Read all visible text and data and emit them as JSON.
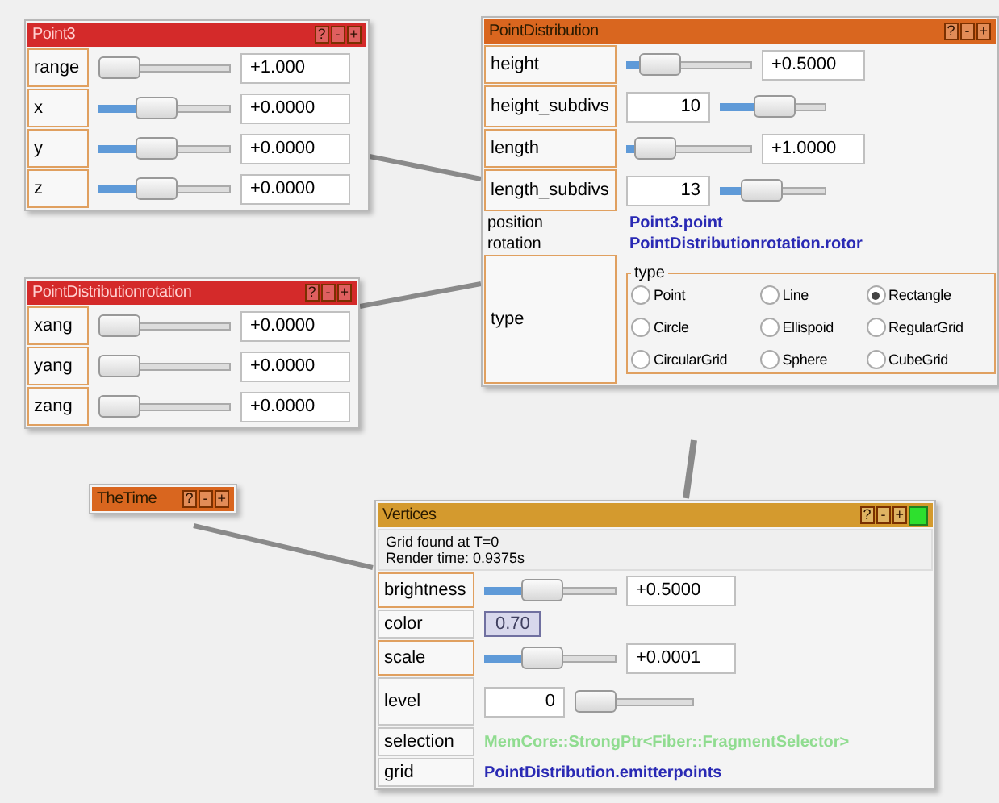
{
  "nodes": [
    {
      "title": "Point3",
      "color": "#d42a2a",
      "buttons": [
        "?",
        "-",
        "+"
      ],
      "indicator": false,
      "rows": [
        {
          "kind": "slider",
          "label": "range",
          "level": 0.0,
          "value": "+1.000"
        },
        {
          "kind": "slider",
          "label": "x",
          "level": 0.4,
          "value": "+0.0000"
        },
        {
          "kind": "slider",
          "label": "y",
          "level": 0.4,
          "value": "+0.0000"
        },
        {
          "kind": "slider",
          "label": "z",
          "level": 0.4,
          "value": "+0.0000"
        }
      ]
    },
    {
      "title": "PointDistributionrotation",
      "color": "#d42a2a",
      "buttons": [
        "?",
        "-",
        "+"
      ],
      "indicator": false,
      "rows": [
        {
          "kind": "slider",
          "label": "xang",
          "level": 0.0,
          "value": "+0.0000"
        },
        {
          "kind": "slider",
          "label": "yang",
          "level": 0.0,
          "value": "+0.0000"
        },
        {
          "kind": "slider",
          "label": "zang",
          "level": 0.0,
          "value": "+0.0000"
        }
      ]
    },
    {
      "title": "PointDistribution",
      "color": "#d9661f",
      "buttons": [
        "?",
        "-",
        "+"
      ],
      "indicator": false,
      "rows": [
        {
          "kind": "slider",
          "label": "height",
          "level": 0.15,
          "value": "+0.5000"
        },
        {
          "kind": "counter",
          "label": "height_subdivs",
          "level": 0.5,
          "value": "10"
        },
        {
          "kind": "slider",
          "label": "length",
          "level": 0.1,
          "value": "+1.0000"
        },
        {
          "kind": "counter",
          "label": "length_subdivs",
          "level": 0.3,
          "value": "13"
        },
        {
          "kind": "link",
          "label": "position",
          "value": "Point3.point",
          "color": "#2a2ab4"
        },
        {
          "kind": "link",
          "label": "rotation",
          "value": "PointDistributionrotation.rotor",
          "color": "#2a2ab4"
        },
        {
          "kind": "radio_group",
          "label": "type",
          "legend": "type",
          "options": [
            {
              "label": "Point",
              "selected": false
            },
            {
              "label": "Line",
              "selected": false
            },
            {
              "label": "Rectangle",
              "selected": true
            },
            {
              "label": "Circle",
              "selected": false
            },
            {
              "label": "Ellispoid",
              "selected": false
            },
            {
              "label": "RegularGrid",
              "selected": false
            },
            {
              "label": "CircularGrid",
              "selected": false
            },
            {
              "label": "Sphere",
              "selected": false
            },
            {
              "label": "CubeGrid",
              "selected": false
            }
          ]
        }
      ]
    },
    {
      "title": "TheTime",
      "color": "#d9661f",
      "buttons": [
        "?",
        "-",
        "+"
      ],
      "indicator": false
    },
    {
      "title": "Vertices",
      "color": "#d49a2e",
      "buttons": [
        "?",
        "-",
        "+"
      ],
      "indicator": true,
      "rows": [
        {
          "kind": "info",
          "lines": [
            "Grid found at T=0",
            "Render time: 0.9375s"
          ]
        },
        {
          "kind": "slider",
          "label": "brightness",
          "level": 0.4,
          "value": "+0.5000"
        },
        {
          "kind": "color",
          "label": "color",
          "value": "0.70"
        },
        {
          "kind": "slider",
          "label": "scale",
          "level": 0.4,
          "value": "+0.0001"
        },
        {
          "kind": "counter",
          "label": "level",
          "level": 0.0,
          "value": "0"
        },
        {
          "kind": "link",
          "label": "selection",
          "value": "MemCore::StrongPtr<Fiber::FragmentSelector>",
          "color": "#90dc90"
        },
        {
          "kind": "link",
          "label": "grid",
          "value": "PointDistribution.emitterpoints",
          "color": "#2a2ab4"
        }
      ]
    }
  ]
}
